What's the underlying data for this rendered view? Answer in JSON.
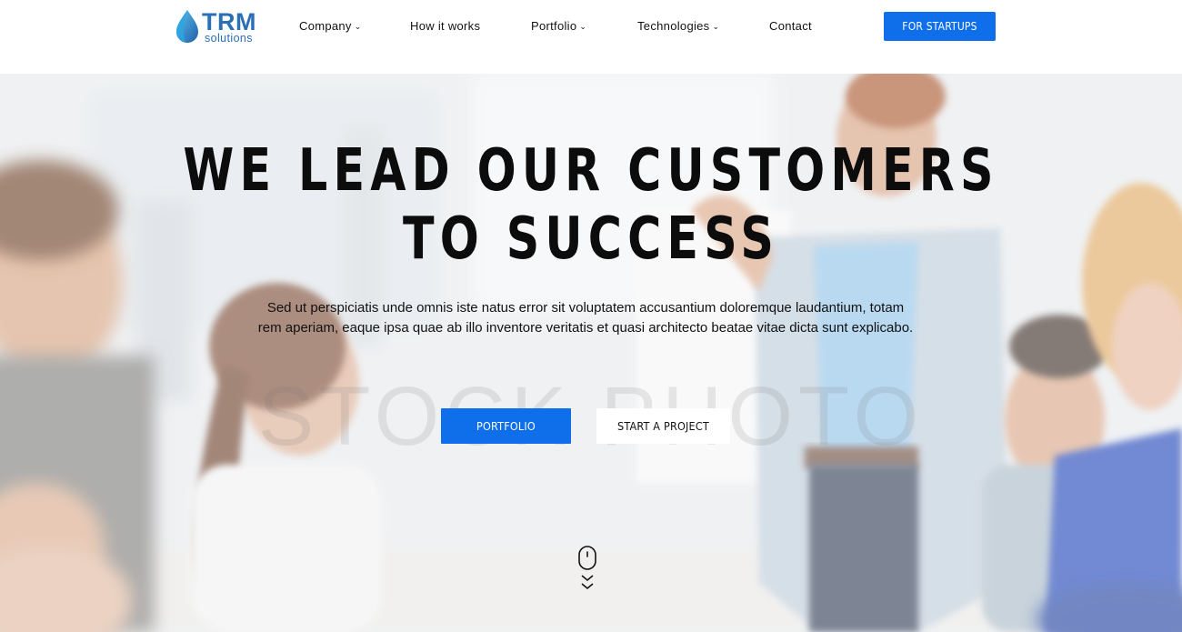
{
  "header": {
    "logo": {
      "brand": "TRM",
      "tagline": "solutions"
    },
    "nav": [
      {
        "label": "Company",
        "has_dropdown": true
      },
      {
        "label": "How it works",
        "has_dropdown": false
      },
      {
        "label": "Portfolio",
        "has_dropdown": true
      },
      {
        "label": "Technologies",
        "has_dropdown": true
      },
      {
        "label": "Contact",
        "has_dropdown": false
      }
    ],
    "cta_label": "FOR STARTUPS"
  },
  "hero": {
    "headline_line1": "WE LEAD OUR CUSTOMERS",
    "headline_line2": "TO SUCCESS",
    "lead": "Sed ut perspiciatis unde omnis iste natus error sit voluptatem accusantium doloremque laudantium, totam rem aperiam, eaque ipsa quae ab illo inventore veritatis et quasi architecto beatae vitae dicta sunt explicabo.",
    "primary_button": "PORTFOLIO",
    "secondary_button": "START A PROJECT",
    "watermark": "STOCK PHOTO",
    "scroll_icon": "mouse-scroll-icon"
  },
  "colors": {
    "accent": "#0f6fea",
    "brand_text": "#2b6fb5",
    "headline": "#0c0c0c"
  }
}
